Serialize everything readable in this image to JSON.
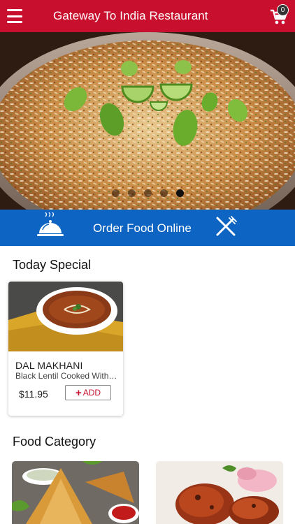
{
  "header": {
    "title": "Gateway To India Restaurant",
    "cart_count": "0"
  },
  "hero": {
    "slide_count": 5,
    "active_slide": 5
  },
  "order_bar": {
    "label": "Order Food Online"
  },
  "today_special": {
    "title": "Today Special",
    "items": [
      {
        "name": "DAL MAKHANI",
        "description": "Black Lentil Cooked With Butter and Cream",
        "price": "$11.95",
        "add_label": "ADD"
      }
    ]
  },
  "food_category": {
    "title": "Food Category"
  },
  "colors": {
    "header_red": "#c8102e",
    "order_blue": "#0d64c2"
  }
}
